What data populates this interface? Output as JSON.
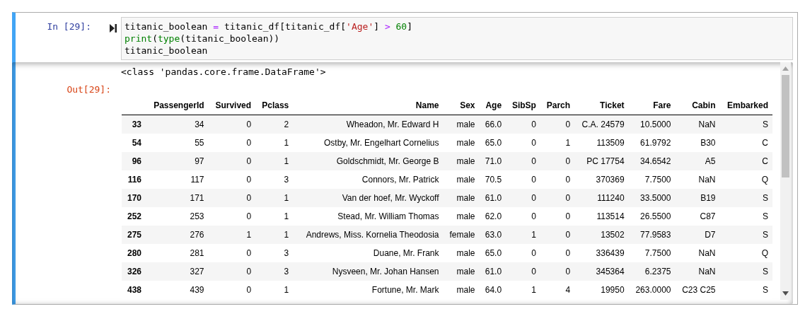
{
  "cell": {
    "in_prompt": "In [29]:",
    "code_lines": [
      [
        {
          "kind": "name",
          "text": "titanic_boolean "
        },
        {
          "kind": "op",
          "text": "="
        },
        {
          "kind": "name",
          "text": " titanic_df[titanic_df["
        },
        {
          "kind": "string",
          "text": "'Age'"
        },
        {
          "kind": "name",
          "text": "] "
        },
        {
          "kind": "op",
          "text": ">"
        },
        {
          "kind": "number",
          "text": " 60"
        },
        {
          "kind": "name",
          "text": "]"
        }
      ],
      [
        {
          "kind": "builtin",
          "text": "print"
        },
        {
          "kind": "name",
          "text": "("
        },
        {
          "kind": "builtin",
          "text": "type"
        },
        {
          "kind": "name",
          "text": "(titanic_boolean))"
        }
      ],
      [
        {
          "kind": "name",
          "text": "titanic_boolean"
        }
      ]
    ],
    "stdout": "<class 'pandas.core.frame.DataFrame'>",
    "out_prompt": "Out[29]:",
    "table": {
      "columns": [
        "",
        "PassengerId",
        "Survived",
        "Pclass",
        "Name",
        "Sex",
        "Age",
        "SibSp",
        "Parch",
        "Ticket",
        "Fare",
        "Cabin",
        "Embarked"
      ],
      "rows": [
        [
          "33",
          "34",
          "0",
          "2",
          "Wheadon, Mr. Edward H",
          "male",
          "66.0",
          "0",
          "0",
          "C.A. 24579",
          "10.5000",
          "NaN",
          "S"
        ],
        [
          "54",
          "55",
          "0",
          "1",
          "Ostby, Mr. Engelhart Cornelius",
          "male",
          "65.0",
          "0",
          "1",
          "113509",
          "61.9792",
          "B30",
          "C"
        ],
        [
          "96",
          "97",
          "0",
          "1",
          "Goldschmidt, Mr. George B",
          "male",
          "71.0",
          "0",
          "0",
          "PC 17754",
          "34.6542",
          "A5",
          "C"
        ],
        [
          "116",
          "117",
          "0",
          "3",
          "Connors, Mr. Patrick",
          "male",
          "70.5",
          "0",
          "0",
          "370369",
          "7.7500",
          "NaN",
          "Q"
        ],
        [
          "170",
          "171",
          "0",
          "1",
          "Van der hoef, Mr. Wyckoff",
          "male",
          "61.0",
          "0",
          "0",
          "111240",
          "33.5000",
          "B19",
          "S"
        ],
        [
          "252",
          "253",
          "0",
          "1",
          "Stead, Mr. William Thomas",
          "male",
          "62.0",
          "0",
          "0",
          "113514",
          "26.5500",
          "C87",
          "S"
        ],
        [
          "275",
          "276",
          "1",
          "1",
          "Andrews, Miss. Kornelia Theodosia",
          "female",
          "63.0",
          "1",
          "0",
          "13502",
          "77.9583",
          "D7",
          "S"
        ],
        [
          "280",
          "281",
          "0",
          "3",
          "Duane, Mr. Frank",
          "male",
          "65.0",
          "0",
          "0",
          "336439",
          "7.7500",
          "NaN",
          "Q"
        ],
        [
          "326",
          "327",
          "0",
          "3",
          "Nysveen, Mr. Johan Hansen",
          "male",
          "61.0",
          "0",
          "0",
          "345364",
          "6.2375",
          "NaN",
          "S"
        ],
        [
          "438",
          "439",
          "0",
          "1",
          "Fortune, Mr. Mark",
          "male",
          "64.0",
          "1",
          "4",
          "19950",
          "263.0000",
          "C23 C25",
          "S"
        ]
      ]
    }
  }
}
